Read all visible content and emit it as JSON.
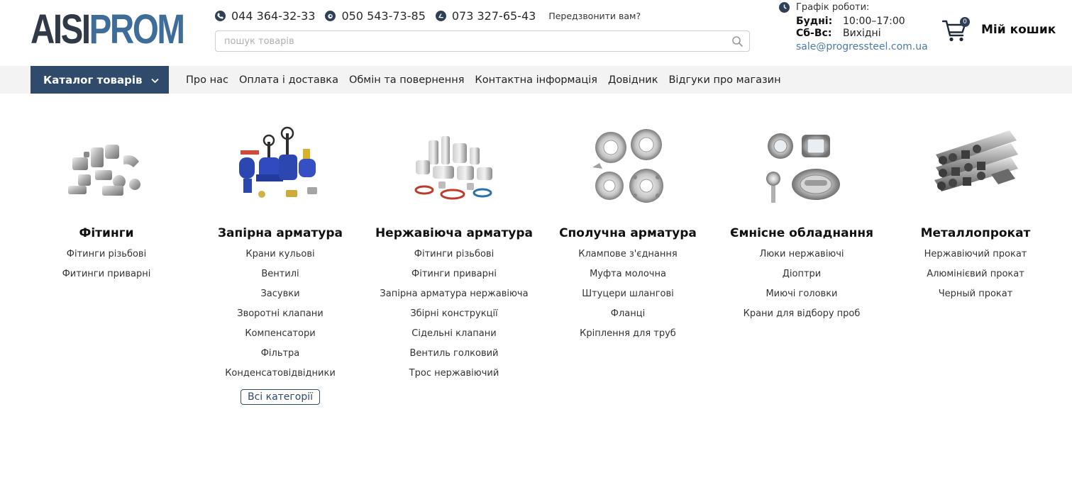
{
  "logo": {
    "part1": "AISI",
    "part2": "PROM"
  },
  "phones": [
    "044 364-32-33",
    "050 543-73-85",
    "073 327-65-43"
  ],
  "callback": "Передзвонити вам?",
  "search": {
    "placeholder": "пошук товарів"
  },
  "schedule": {
    "title": "Графік роботи:",
    "rows": [
      {
        "label": "Будні:",
        "value": "10:00–17:00"
      },
      {
        "label": "Сб-Вс:",
        "value": "Вихідні"
      }
    ],
    "email": "sale@progressteel.com.ua"
  },
  "cart": {
    "count": "0",
    "label": "Мій кошик"
  },
  "nav": {
    "catalog": "Каталог товарів",
    "links": [
      "Про нас",
      "Оплата і доставка",
      "Обмін та повернення",
      "Контактна інформація",
      "Довідник",
      "Відгуки про магазин"
    ]
  },
  "categories": [
    {
      "title": "Фітинги",
      "items": [
        "Фітинги різьбові",
        "Фитинги приварні"
      ]
    },
    {
      "title": "Запірна арматура",
      "items": [
        "Крани кульові",
        "Вентилі",
        "Засувки",
        "Зворотні клапани",
        "Компенсатори",
        "Фільтра",
        "Конденсатовідвідники"
      ],
      "all": "Всі категорії"
    },
    {
      "title": "Нержавіюча арматура",
      "items": [
        "Фітинги різьбові",
        "Фітинги приварні",
        "Запірна арматура нержавіюча",
        "Збірні конструкції",
        "Сідельні клапани",
        "Вентиль голковий",
        "Трос нержавіючий"
      ]
    },
    {
      "title": "Сполучна арматура",
      "items": [
        "Клампове з'єднання",
        "Муфта молочна",
        "Штуцери шлангові",
        "Фланці",
        "Кріплення для труб"
      ]
    },
    {
      "title": "Ємнісне обладнання",
      "items": [
        "Люки нержавіючі",
        "Діоптри",
        "Миючі головки",
        "Крани для відбору проб"
      ]
    },
    {
      "title": "Металлопрокат",
      "items": [
        "Нержавіючий прокат",
        "Алюмінієвий прокат",
        "Черный прокат"
      ]
    }
  ],
  "colors": {
    "brand_dark": "#2f4a6b",
    "brand_accent": "#3f6d99",
    "nav_bg": "#f3f3f3",
    "email": "#4a7aa8"
  }
}
